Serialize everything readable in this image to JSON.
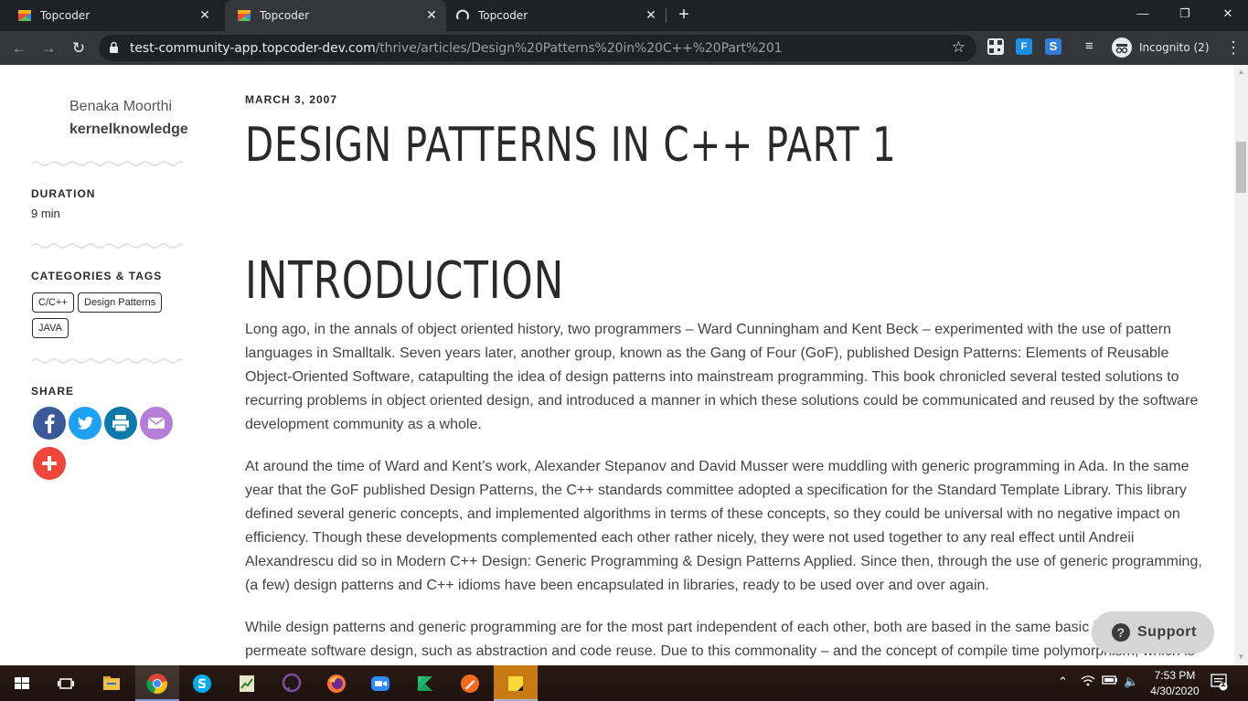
{
  "browser": {
    "tabs": [
      {
        "title": "Topcoder",
        "active": false
      },
      {
        "title": "Topcoder",
        "active": true
      },
      {
        "title": "Topcoder",
        "active": false,
        "loading": true
      }
    ],
    "url_host": "test-community-app.topcoder-dev.com",
    "url_path": "/thrive/articles/Design%20Patterns%20in%20C++%20Part%201",
    "incognito_label": "Incognito (2)"
  },
  "sidebar": {
    "author_name": "Benaka Moorthi",
    "author_handle": "kernelknowledge",
    "duration_label": "DURATION",
    "duration_value": "9 min",
    "categories_label": "CATEGORIES & TAGS",
    "tags": [
      "C/C++",
      "Design Patterns",
      "JAVA"
    ],
    "share_label": "SHARE",
    "share_icons": [
      "facebook-icon",
      "twitter-icon",
      "print-icon",
      "email-icon",
      "more-plus-icon"
    ],
    "share_colors": {
      "facebook": "#3b5998",
      "twitter": "#1da1f2",
      "print": "#0c79ab",
      "email": "#b57ed9",
      "more": "#f0453a"
    }
  },
  "article": {
    "date": "MARCH 3, 2007",
    "title": "DESIGN PATTERNS IN C++ PART 1",
    "section_heading": "INTRODUCTION",
    "paragraphs": [
      "Long ago, in the annals of object oriented history, two programmers – Ward Cunningham and Kent Beck – experimented with the use of pattern languages in Smalltalk. Seven years later, another group, known as the Gang of Four (GoF), published Design Patterns: Elements of Reusable Object-Oriented Software, catapulting the idea of design patterns into mainstream programming. This book chronicled several tested solutions to recurring problems in object oriented design, and introduced a manner in which these solutions could be communicated and reused by the software development community as a whole.",
      "At around the time of Ward and Kent’s work, Alexander Stepanov and David Musser were muddling with generic programming in Ada. In the same year that the GoF published Design Patterns, the C++ standards committee adopted a specification for the Standard Template Library. This library defined several generic concepts, and implemented algorithms in terms of these concepts, so they could be universal with no negative impact on efficiency. Though these developments complemented each other rather nicely, they were not used together to any real effect until Andreii Alexandrescu did so in Modern C++ Design: Generic Programming & Design Patterns Applied. Since then, through the use of generic programming, (a few) design patterns and C++ idioms have been encapsulated in libraries, ready to be used over and over again.",
      "While design patterns and generic programming are for the most part independent of each other, both are based in the same basic ideas that permeate software design, such as abstraction and code reuse. Due to this commonality – and the concept of compile time polymorphism, which is"
    ]
  },
  "support_button": "Support",
  "taskbar": {
    "time": "7:53 PM",
    "date": "4/30/2020",
    "notifications": "1"
  },
  "colors": {
    "accent_text": "#2a2a2a",
    "body_text": "#444444",
    "chrome_dark": "#202124",
    "chrome_toolbar": "#35363a"
  }
}
